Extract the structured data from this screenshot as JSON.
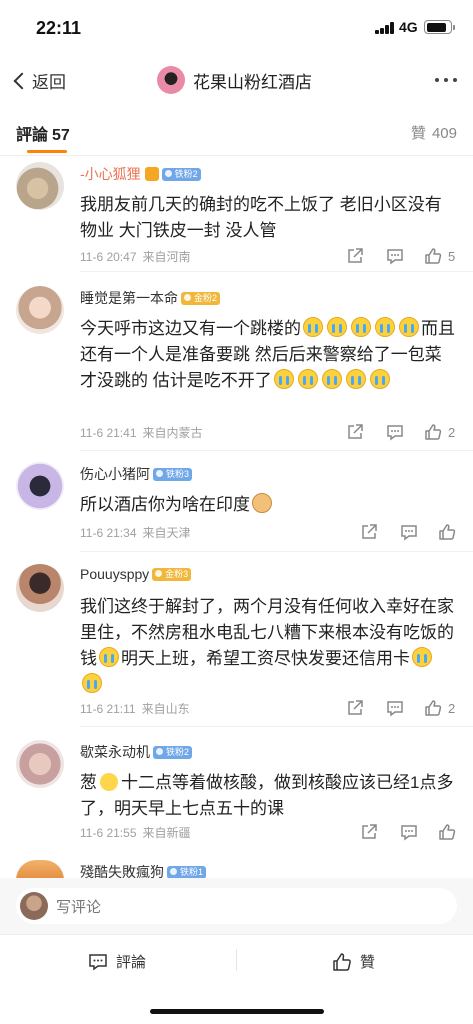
{
  "status_bar": {
    "time": "22:11",
    "network": "4G"
  },
  "nav": {
    "back_label": "返回",
    "title": "花果山粉红酒店"
  },
  "tabs": {
    "comments_label": "評論",
    "comments_count": "57",
    "likes_label": "贊",
    "likes_count": "409"
  },
  "comments": [
    {
      "username": "-小心狐狸",
      "badge": "铁粉2",
      "text": "我朋友前几天的确封的吃不上饭了 老旧小区没有物业 大门铁皮一封 没人管",
      "time": "11-6 20:47",
      "source": "来自河南",
      "likes": "5"
    },
    {
      "username": "睡觉是第一本命",
      "badge": "金粉2",
      "text_1": "今天呼市这边又有一个跳楼的",
      "text_2": "而且还有一个人是准备要跳 然后后来警察给了一包菜才没跳的 估计是吃不开了",
      "time": "11-6 21:41",
      "source": "来自内蒙古",
      "likes": "2"
    },
    {
      "username": "伤心小猪阿",
      "badge": "铁粉3",
      "text": "所以酒店你为啥在印度",
      "time": "11-6 21:34",
      "source": "来自天津",
      "likes": ""
    },
    {
      "username": "Pouuyspру",
      "badge": "金粉3",
      "text_1": "我们这终于解封了，两个月没有任何收入幸好在家里住，不然房租水电乱七八糟下来根本没有吃饭的钱",
      "text_2": "明天上班，希望工资尽快发要还信用卡",
      "time": "11-6 21:11",
      "source": "来自山东",
      "likes": "2"
    },
    {
      "username": "歇菜永动机",
      "badge": "铁粉2",
      "text_1": "葱",
      "text_2": "十二点等着做核酸，做到核酸应该已经1点多了，明天早上七点五十的课",
      "time": "11-6 21:55",
      "source": "来自新疆",
      "likes": ""
    },
    {
      "username": "殘酷失敗瘋狗",
      "badge": "铁粉1"
    }
  ],
  "input": {
    "placeholder": "写评论"
  },
  "bottom_bar": {
    "comment_label": "評論",
    "like_label": "贊"
  },
  "colors": {
    "accent": "#ff8200",
    "username_highlight": "#eb7350",
    "meta_gray": "#a0a0a0"
  }
}
